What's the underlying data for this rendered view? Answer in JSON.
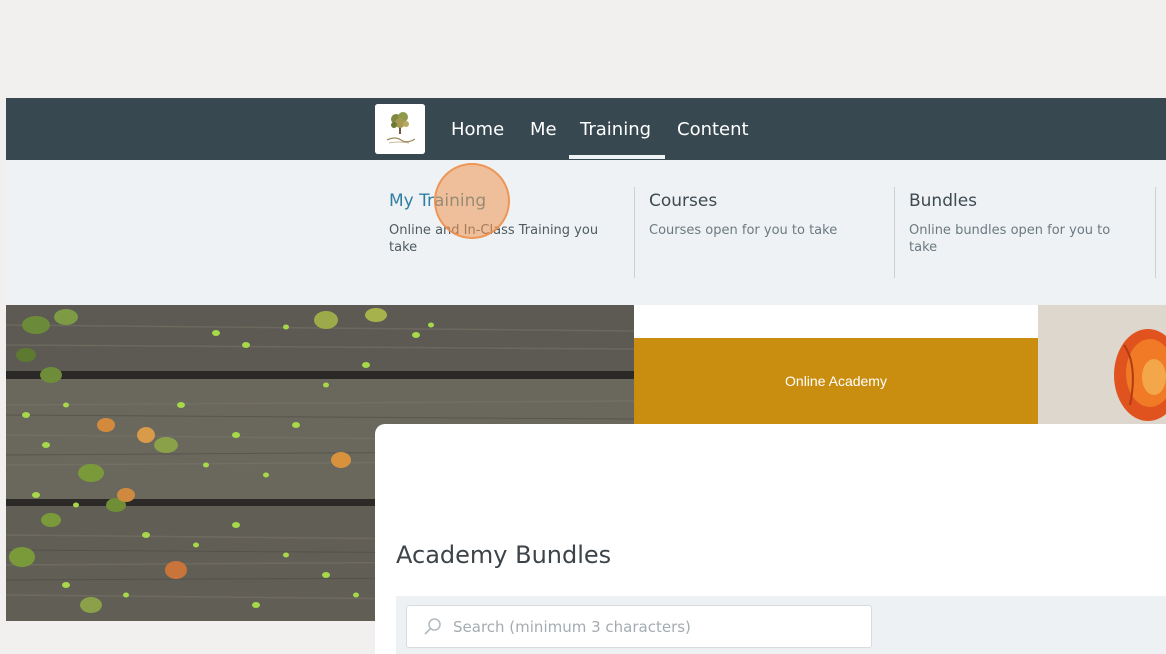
{
  "nav": {
    "items": [
      {
        "label": "Home"
      },
      {
        "label": "Me"
      },
      {
        "label": "Training"
      },
      {
        "label": "Content"
      }
    ],
    "active": "Training",
    "logo_icon": "tree-logo-icon"
  },
  "dropdown": {
    "columns": [
      {
        "title": "My Training",
        "description": "Online and In-Class Training you take"
      },
      {
        "title": "Courses",
        "description": "Courses open for you to take"
      },
      {
        "title": "Bundles",
        "description": "Online bundles open for you to take"
      }
    ]
  },
  "hero": {
    "banner_label": "Online Academy"
  },
  "main": {
    "title": "Academy Bundles",
    "search": {
      "placeholder": "Search (minimum 3 characters)",
      "value": "",
      "icon": "search-icon"
    }
  },
  "colors": {
    "nav_bg": "#374850",
    "dropdown_bg": "#eef2f5",
    "active_link": "#2f7fa5",
    "banner_bg": "#c98e10",
    "click_marker": "#f0a060"
  }
}
